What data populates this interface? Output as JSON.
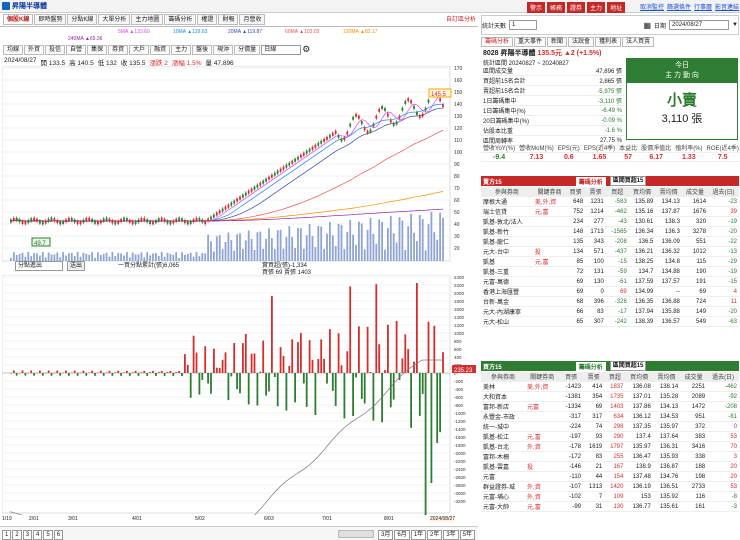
{
  "app": {
    "title": "昇陽半導體",
    "links": [
      "個股資訊",
      "選股",
      "自選股",
      "說明",
      "交易"
    ]
  },
  "top_buttons": [
    "警示",
    "帳務",
    "證券",
    "主力",
    "地址"
  ],
  "top_right_links": [
    "取消監控",
    "篩選條件",
    "行事曆",
    "影音連結"
  ],
  "tabs": [
    "個股K線",
    "即時盤勢",
    "分點K線",
    "大單分析",
    "主力地圖",
    "籌碼分析",
    "權證",
    "財報",
    "月營收"
  ],
  "tabs_extra": "自訂區分析",
  "toolbar": [
    "均線",
    "外資",
    "投信",
    "自營",
    "集保",
    "券資",
    "大戶",
    "融資",
    "主力",
    "盤後",
    "現沖",
    "分價量"
  ],
  "toolbar_select": "日線",
  "ma_legend": [
    {
      "label": "5MA ▲133.60",
      "color": "#e040fb"
    },
    {
      "label": "10MA ▲129.63",
      "color": "#1e88e5"
    },
    {
      "label": "20MA ▲119.87",
      "color": "#3949ab"
    },
    {
      "label": "60MA ▲103.03",
      "color": "#ef5350"
    },
    {
      "label": "120MA ▲83.17",
      "color": "#fb8c00"
    },
    {
      "label": "240MA ▲65.36",
      "color": "#8e24aa"
    }
  ],
  "ohlc": {
    "date": "2024/08/27",
    "open": "開 133.5",
    "high": "高 140.5",
    "low": "低 132",
    "close": "收 135.5",
    "change": "漲跌 2",
    "pct": "漲幅 1.5%",
    "vol": "量 47,896"
  },
  "price_axis": [
    "170",
    "160",
    "150",
    "140",
    "130",
    "120",
    "110",
    "100",
    "90",
    "80",
    "70",
    "60",
    "50",
    "40",
    "30",
    "20"
  ],
  "price_labels": {
    "high": "145.5",
    "low": "49.7"
  },
  "lower": {
    "select": "分點進出",
    "btn": "送出",
    "legend1": "一買分點累計(張)6,065",
    "legend2": "實買超(張)-1,334",
    "legend3": "買張 69 賣張 1403",
    "value": "235.23"
  },
  "lower_axis": [
    "2400",
    "2200",
    "2000",
    "1800",
    "1600",
    "1400",
    "1200",
    "1000",
    "800",
    "600",
    "400",
    "200",
    "0",
    "-200",
    "-400",
    "-600",
    "-800",
    "-1000",
    "-1200",
    "-1400",
    "-1600",
    "-1800",
    "-2000",
    "-2200",
    "-2400",
    "-2600",
    "-2800",
    "-3000",
    "-3200"
  ],
  "dates": [
    "1/19",
    "2/01",
    "3/01",
    "4/01",
    "5/02",
    "6/03",
    "7/01",
    "8/01",
    "2024/08/27"
  ],
  "pager": [
    "1",
    "2",
    "3",
    "4",
    "5",
    "6"
  ],
  "ranges": [
    "3月",
    "6月",
    "1年",
    "2年",
    "3年",
    "5年"
  ],
  "right": {
    "date_label": "日期",
    "date": "2024/08/27",
    "days_label": "統計天數",
    "days": "1",
    "stock": "8028 昇陽半導體",
    "price": "135.5元",
    "chg": "▲2 (+1.5%)",
    "period": "統計區間 20240827 ~ 20240827",
    "summary": [
      [
        "區間成交量",
        "47,896 張"
      ],
      [
        "買超前15名合計",
        "2,865 張"
      ],
      [
        "賣超前15名合計",
        "-5,975 張"
      ],
      [
        "1日籌碼集中",
        "-3,110 張"
      ],
      [
        "1日籌碼集中(%)",
        "-6.49 %"
      ],
      [
        "20日籌碼集中(%)",
        "-0.09 %"
      ],
      [
        "佔股本比重",
        "-1.6 %"
      ],
      [
        "區間周轉率",
        "27.75 %"
      ]
    ],
    "today_label": "今日",
    "today_sub": "主 力 動 向",
    "verdict": "小賣",
    "verdict_val": "3,110 張",
    "subtabs": [
      "籌碼分析",
      "重大事件",
      "新聞",
      "法說會",
      "獲利表",
      "法人買賣"
    ],
    "metrics_head": [
      "營收YoY(%)",
      "營收MoM(%)",
      "EPS(元)",
      "EPS(近4季)",
      "本益比",
      "股價淨值比",
      "殖利率(%)",
      "ROE(近4季)"
    ],
    "metrics": [
      "-9.4",
      "7.13",
      "0.6",
      "1.65",
      "57",
      "6.17",
      "1.33",
      "7.5"
    ],
    "sell_title": "賣方15",
    "buy_title": "買方15",
    "btn": "籌碼分析",
    "select": "區間買超15",
    "cols": [
      "參與券商",
      "關鍵券商",
      "買張",
      "賣張",
      "買超",
      "買均價",
      "賣均價",
      "成交量",
      "過去(日)"
    ],
    "sell": [
      [
        "摩根大通",
        "美,外,資",
        "648",
        "1231",
        "-583",
        "135.89",
        "134.13",
        "1614",
        "-23"
      ],
      [
        "瑞士信貸",
        "元,富",
        "752",
        "1214",
        "-462",
        "135.16",
        "137.87",
        "1676",
        "39"
      ],
      [
        "凱基-敦北/法人",
        "",
        "234",
        "277",
        "-43",
        "130.61",
        "138.3",
        "320",
        "-19"
      ],
      [
        "凱基-新竹",
        "",
        "148",
        "1713",
        "-1565",
        "136.34",
        "136.3",
        "3278",
        "-20"
      ],
      [
        "凱基-龍仁",
        "",
        "135",
        "343",
        "-208",
        "136.5",
        "136.09",
        "551",
        "-22"
      ],
      [
        "元大-台中",
        "投",
        "134",
        "571",
        "-437",
        "136.21",
        "136.32",
        "1012",
        "-13"
      ],
      [
        "凱基",
        "元,富",
        "85",
        "100",
        "-15",
        "138.25",
        "134.8",
        "115",
        "-29"
      ],
      [
        "凱基-三重",
        "",
        "72",
        "131",
        "-59",
        "134.7",
        "134.88",
        "190",
        "-19"
      ],
      [
        "元富-萬德",
        "",
        "69",
        "130",
        "-61",
        "137.59",
        "137.57",
        "191",
        "-15"
      ],
      [
        "香港上海匯豐",
        "",
        "69",
        "0",
        "69",
        "134.99",
        "--",
        "69",
        "4"
      ],
      [
        "台新-萬金",
        "",
        "68",
        "396",
        "-328",
        "136.35",
        "136.88",
        "724",
        "11"
      ],
      [
        "元大-內湖康寧",
        "",
        "66",
        "83",
        "-17",
        "137.94",
        "135.88",
        "149",
        "-20"
      ],
      [
        "元大-松山",
        "",
        "65",
        "307",
        "-242",
        "138.39",
        "136.57",
        "549",
        "-63"
      ]
    ],
    "buy": [
      [
        "美林",
        "美,外,資",
        "-1423",
        "414",
        "1837",
        "136.08",
        "138.14",
        "2251",
        "-462"
      ],
      [
        "大和資本",
        "",
        "-1381",
        "354",
        "1735",
        "137.01",
        "135.28",
        "2089",
        "-92"
      ],
      [
        "富邦-新店",
        "元富",
        "-1334",
        "69",
        "1403",
        "137.86",
        "134.13",
        "1472",
        "-208"
      ],
      [
        "永豐金-市政",
        "",
        "-317",
        "317",
        "634",
        "136.12",
        "134.53",
        "951",
        "-81"
      ],
      [
        "統一-城中",
        "",
        "-224",
        "74",
        "298",
        "137.35",
        "135.97",
        "372",
        "0"
      ],
      [
        "凱基-松江",
        "元,富",
        "-197",
        "93",
        "290",
        "137.4",
        "137.64",
        "383",
        "53"
      ],
      [
        "凱基-台北",
        "外,資",
        "-178",
        "1619",
        "1797",
        "135.97",
        "136.31",
        "3416",
        "70"
      ],
      [
        "富邦-木柵",
        "",
        "-172",
        "83",
        "255",
        "136.47",
        "135.93",
        "338",
        "3"
      ],
      [
        "凱基-雲嘉",
        "投",
        "-146",
        "21",
        "167",
        "138.9",
        "136.87",
        "188",
        "20"
      ],
      [
        "元富",
        "",
        "-110",
        "44",
        "154",
        "137.48",
        "134.76",
        "198",
        "20"
      ],
      [
        "群益證券-城",
        "外,資",
        "-107",
        "1313",
        "1420",
        "136.19",
        "136.51",
        "2733",
        "53"
      ],
      [
        "元富-埔心",
        "外,資",
        "-102",
        "7",
        "109",
        "153",
        "135.92",
        "116",
        "-8"
      ],
      [
        "元富-大帥",
        "元,富",
        "-99",
        "31",
        "130",
        "136.77",
        "135.61",
        "161",
        "-3"
      ]
    ]
  }
}
